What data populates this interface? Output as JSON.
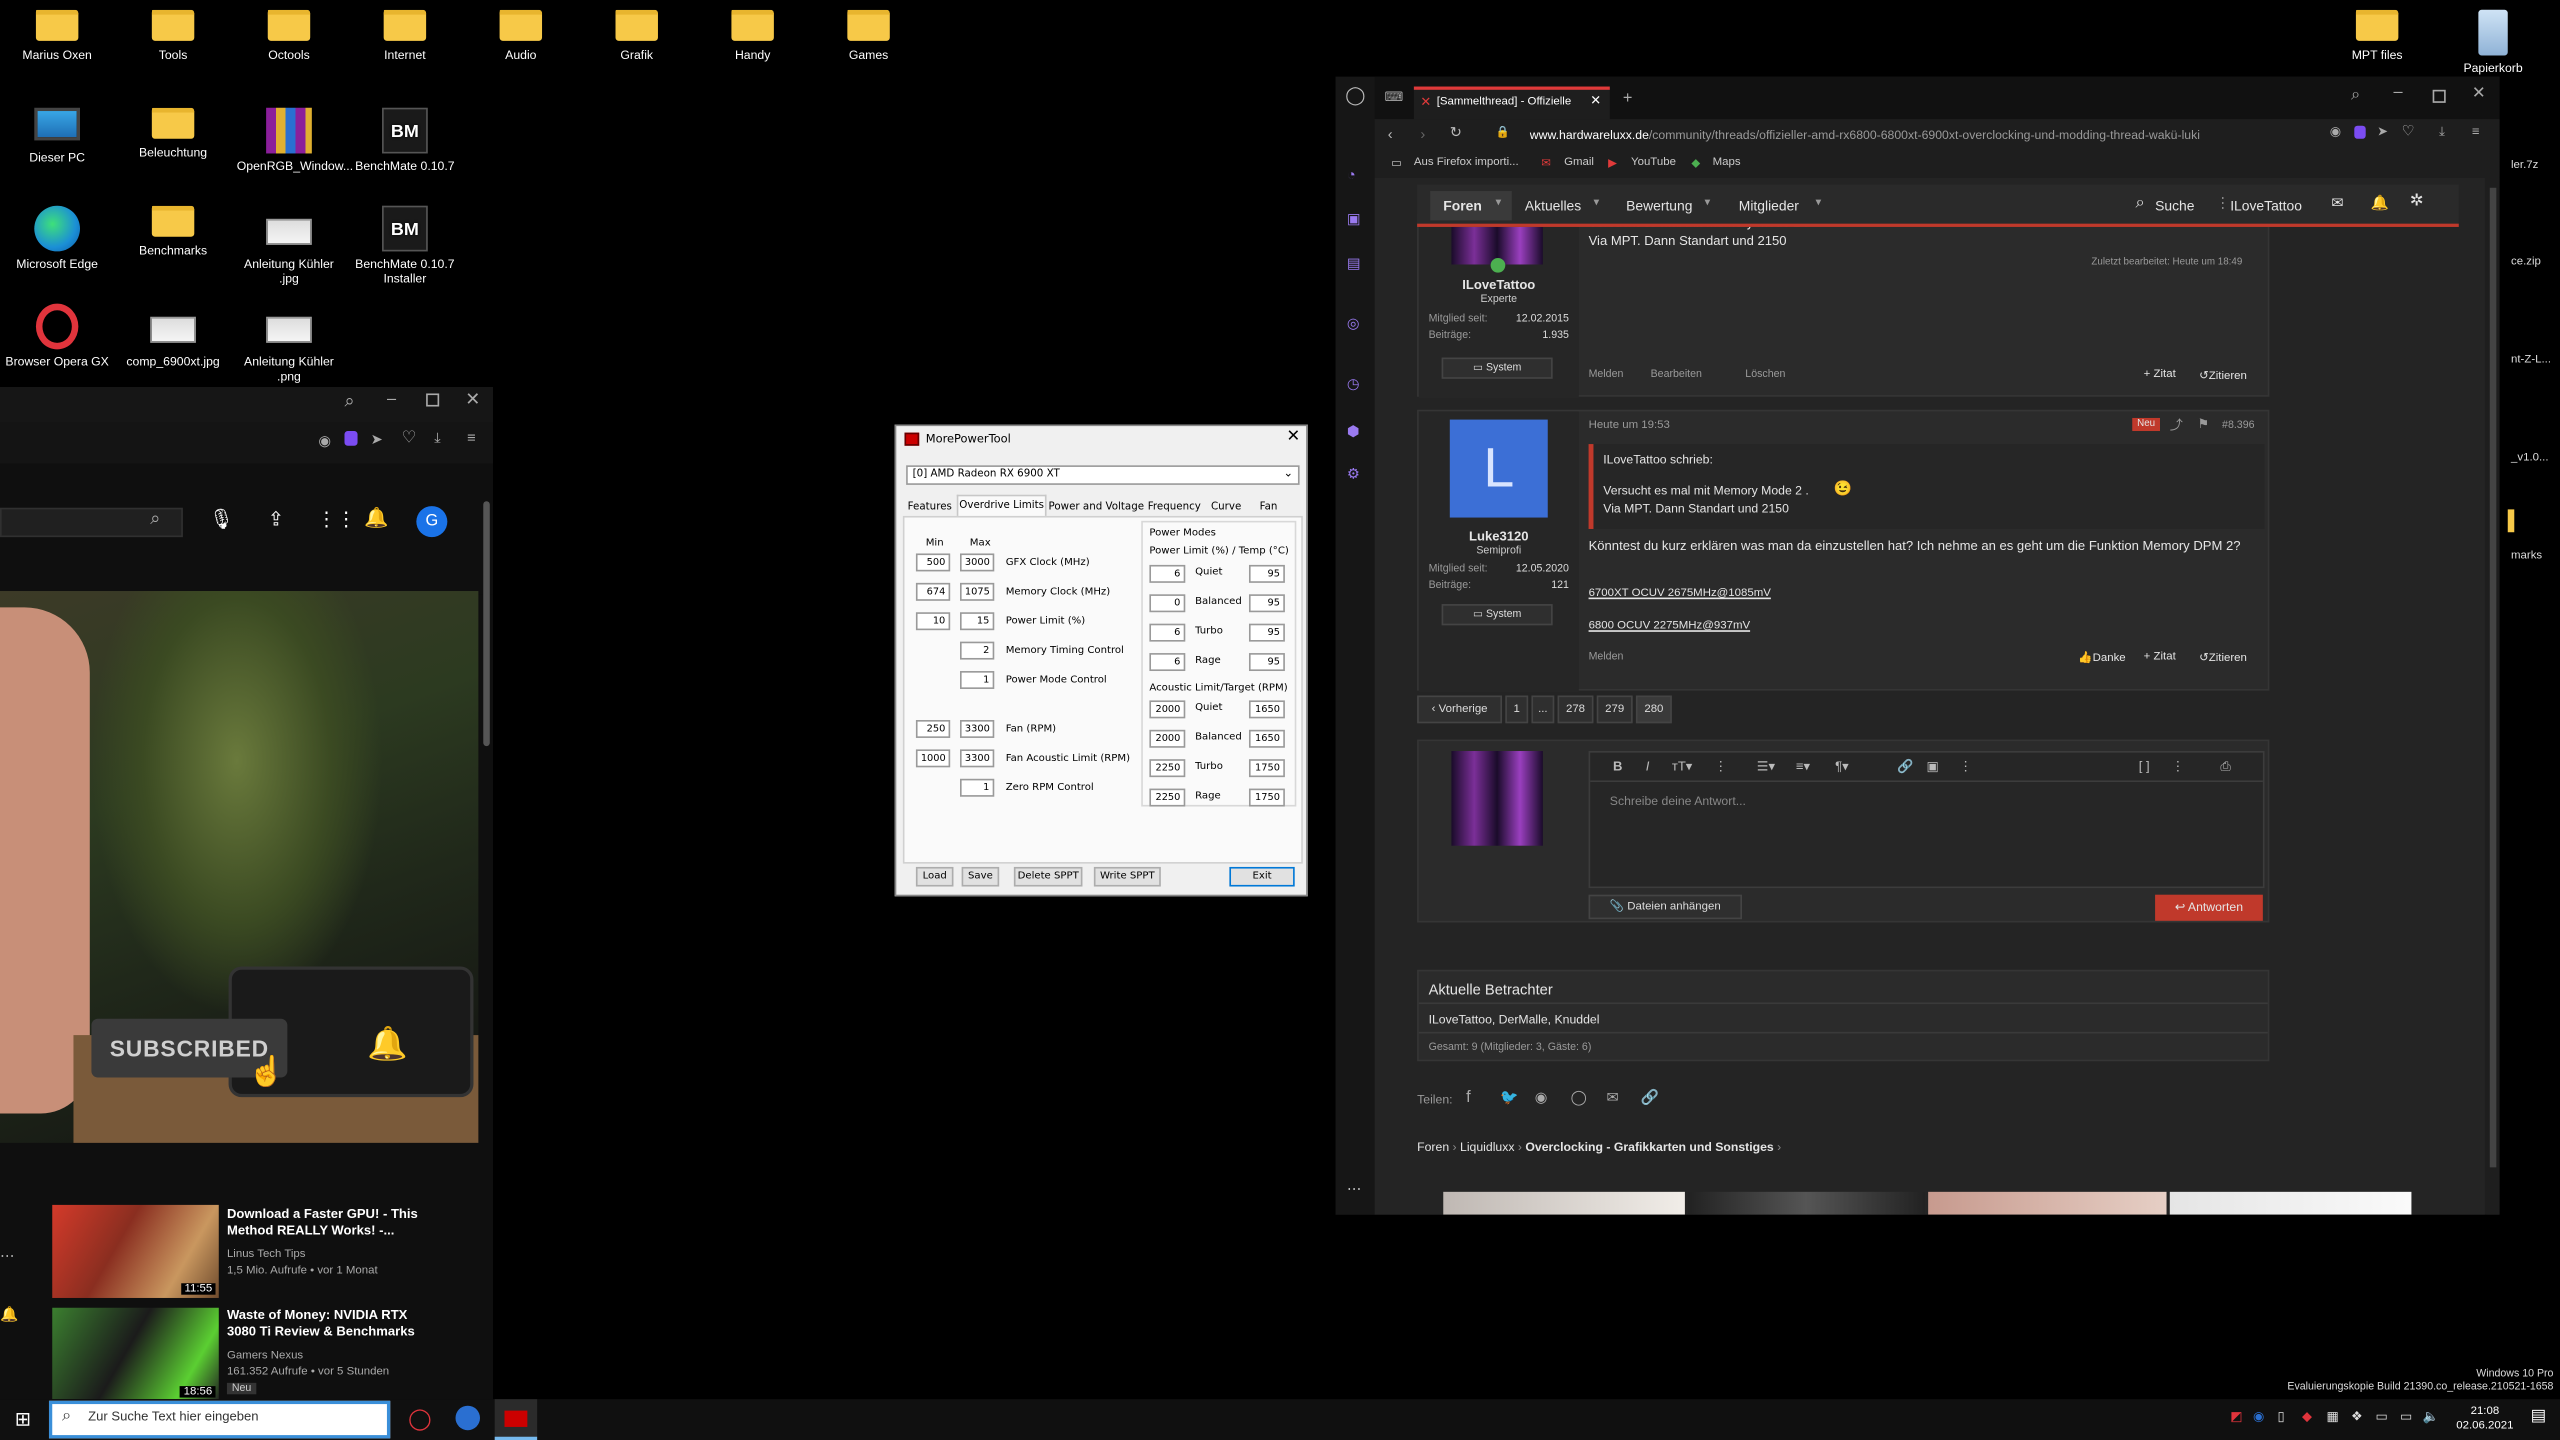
{
  "desktop": {
    "icons": [
      {
        "label": "Marius Oxen",
        "kind": "folder"
      },
      {
        "label": "Tools",
        "kind": "folder"
      },
      {
        "label": "Octools",
        "kind": "folder"
      },
      {
        "label": "Internet",
        "kind": "folder"
      },
      {
        "label": "Audio",
        "kind": "folder"
      },
      {
        "label": "Grafik",
        "kind": "folder"
      },
      {
        "label": "Handy",
        "kind": "folder"
      },
      {
        "label": "Games",
        "kind": "folder"
      },
      {
        "label": "Dieser PC",
        "kind": "monitor-icon"
      },
      {
        "label": "Beleuchtung",
        "kind": "folder"
      },
      {
        "label": "OpenRGB_Window...",
        "kind": "archive-icon"
      },
      {
        "label": "BenchMate 0.10.7",
        "kind": "benchmate-icon"
      },
      {
        "label": "Microsoft Edge",
        "kind": "edge-icon"
      },
      {
        "label": "Benchmarks",
        "kind": "folder"
      },
      {
        "label": "Anleitung Kühler .jpg",
        "kind": "image-icon"
      },
      {
        "label": "BenchMate 0.10.7 Installer",
        "kind": "benchmate-icon"
      },
      {
        "label": "Browser Opera GX",
        "kind": "opera-icon"
      },
      {
        "label": "comp_6900xt.jpg",
        "kind": "image-icon"
      },
      {
        "label": "Anleitung Kühler .png",
        "kind": "image-icon"
      }
    ],
    "right_icons": [
      {
        "label": "MPT files",
        "kind": "folder"
      },
      {
        "label": "Papierkorb",
        "kind": "recycle-bin-icon"
      }
    ],
    "side_labels": [
      "ler.7z",
      "ce.zip",
      "nt-Z-L...",
      "_v1.0...",
      "marks"
    ],
    "watermark": [
      "Windows 10 Pro",
      "Evaluierungskopie Build 21390.co_release.210521-1658"
    ]
  },
  "mpt": {
    "title": "MorePowerTool",
    "gpu": "[0] AMD Radeon RX 6900 XT",
    "tabs": [
      "Features",
      "Overdrive Limits",
      "Power and Voltage",
      "Frequency",
      "Curve",
      "Fan"
    ],
    "active_tab": "Overdrive Limits",
    "col_min": "Min",
    "col_max": "Max",
    "rows": [
      {
        "min": "500",
        "max": "3000",
        "label": "GFX Clock (MHz)"
      },
      {
        "min": "674",
        "max": "1075",
        "label": "Memory Clock (MHz)"
      },
      {
        "min": "10",
        "max": "15",
        "label": "Power Limit (%)"
      },
      {
        "min": "",
        "max": "2",
        "label": "Memory Timing Control"
      },
      {
        "min": "",
        "max": "1",
        "label": "Power Mode Control"
      },
      {
        "min": "250",
        "max": "3300",
        "label": "Fan (RPM)"
      },
      {
        "min": "1000",
        "max": "3300",
        "label": "Fan Acoustic Limit (RPM)"
      },
      {
        "min": "",
        "max": "1",
        "label": "Zero RPM Control"
      }
    ],
    "power_modes_title": "Power Modes",
    "power_limit_header": "Power Limit (%) / Temp (°C)",
    "power_modes": [
      {
        "limit": "6",
        "name": "Quiet",
        "temp": "95"
      },
      {
        "limit": "0",
        "name": "Balanced",
        "temp": "95"
      },
      {
        "limit": "6",
        "name": "Turbo",
        "temp": "95"
      },
      {
        "limit": "6",
        "name": "Rage",
        "temp": "95"
      }
    ],
    "acoustic_header": "Acoustic Limit/Target (RPM)",
    "acoustic": [
      {
        "limit": "2000",
        "name": "Quiet",
        "target": "1650"
      },
      {
        "limit": "2000",
        "name": "Balanced",
        "target": "1650"
      },
      {
        "limit": "2250",
        "name": "Turbo",
        "target": "1750"
      },
      {
        "limit": "2250",
        "name": "Rage",
        "target": "1750"
      }
    ],
    "buttons": [
      "Load",
      "Save",
      "Delete SPPT",
      "Write SPPT",
      "Exit"
    ]
  },
  "youtube": {
    "subscribed": "SUBSCRIBED",
    "avatar_letter": "G",
    "videos": [
      {
        "title": "Download a Faster GPU! - This Method REALLY Works! -...",
        "channel": "Linus Tech Tips",
        "meta": "1,5 Mio. Aufrufe • vor 1 Monat",
        "duration": "11:55"
      },
      {
        "title": "Waste of Money: NVIDIA RTX 3080 Ti Review & Benchmarks",
        "channel": "Gamers Nexus",
        "meta": "161.352 Aufrufe • vor 5 Stunden",
        "duration": "18:56",
        "badge": "Neu"
      }
    ]
  },
  "browser": {
    "tab_title": "[Sammelthread] - Offizielle",
    "url_prefix": "www.hardwareluxx.de",
    "url_rest": "/community/threads/offizieller-amd-rx6800-6800xt-6900xt-overclocking-und-modding-thread-wakü-luki",
    "bookmarks": [
      "Aus Firefox importi...",
      "Gmail",
      "YouTube",
      "Maps"
    ],
    "nav": [
      "Foren",
      "Aktuelles",
      "Bewertung",
      "Mitglieder"
    ],
    "search": "Suche",
    "user": "ILoveTattoo",
    "post1": {
      "quote_line1": "Versucht es mal mit Memory Mode 2 .",
      "line2": "Via MPT. Dann Standart und 2150",
      "author": "ILoveTattoo",
      "role": "Experte",
      "member_since_label": "Mitglied seit:",
      "member_since": "12.02.2015",
      "posts_label": "Beiträge:",
      "posts": "1.935",
      "system": "System",
      "edited": "Zuletzt bearbeitet: Heute um 18:49",
      "actions": [
        "Melden",
        "Bearbeiten",
        "Löschen"
      ],
      "quote_btn": "+ Zitat",
      "cite_btn": "Zitieren"
    },
    "post2": {
      "time": "Heute um 19:53",
      "badge": "Neu",
      "number": "#8.396",
      "avatar_letter": "L",
      "author": "Luke3120",
      "role": "Semiprofi",
      "member_since_label": "Mitglied seit:",
      "member_since": "12.05.2020",
      "posts_label": "Beiträge:",
      "posts": "121",
      "system": "System",
      "quote_author": "ILoveTattoo schrieb:",
      "quote_line1": "Versucht es mal mit Memory Mode 2 .",
      "quote_line2": "Via MPT. Dann Standart und 2150",
      "body": "Könntest du kurz erklären was man da einzustellen hat? Ich nehme an es geht um die Funktion Memory DPM 2?",
      "sig1": "6700XT OCUV 2675MHz@1085mV",
      "sig2": "6800 OCUV 2275MHz@937mV",
      "report": "Melden",
      "thanks": "Danke",
      "quote_btn": "+ Zitat",
      "cite_btn": "Zitieren"
    },
    "pagination": [
      "‹ Vorherige",
      "1",
      "...",
      "278",
      "279",
      "280"
    ],
    "editor_placeholder": "Schreibe deine Antwort...",
    "attach": "Dateien anhängen",
    "reply": "Antworten",
    "viewers_title": "Aktuelle Betrachter",
    "viewers": "ILoveTattoo, DerMalle, Knuddel",
    "viewers_total": "Gesamt: 9 (Mitglieder: 3, Gäste: 6)",
    "share_label": "Teilen:",
    "breadcrumb": [
      "Foren",
      "Liquidluxx",
      "Overclocking - Grafikkarten und Sonstiges"
    ]
  },
  "taskbar": {
    "search_placeholder": "Zur Suche Text hier eingeben",
    "time": "21:08",
    "date": "02.06.2021"
  }
}
